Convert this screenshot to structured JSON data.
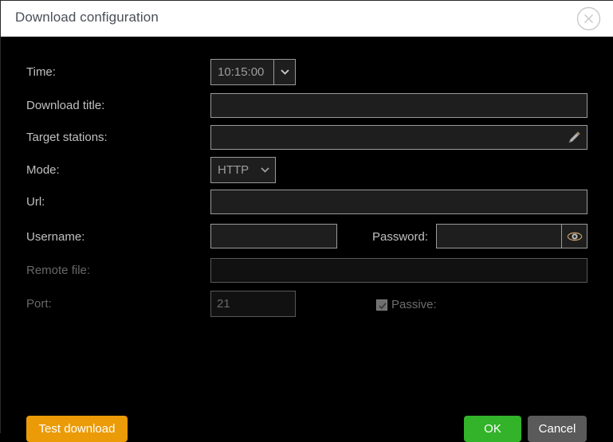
{
  "titlebar": {
    "title": "Download configuration",
    "close_icon": "close-circle-icon"
  },
  "form": {
    "time": {
      "label": "Time:",
      "value": "10:15:00",
      "arrow_icon": "chevron-down-icon"
    },
    "download_title": {
      "label": "Download title:",
      "value": ""
    },
    "target_stations": {
      "label": "Target stations:",
      "value": "",
      "edit_icon": "pencil-icon"
    },
    "mode": {
      "label": "Mode:",
      "value": "HTTP",
      "arrow_icon": "chevron-down-icon"
    },
    "url": {
      "label": "Url:",
      "value": ""
    },
    "username": {
      "label": "Username:",
      "value": ""
    },
    "password": {
      "label": "Password:",
      "value": "",
      "reveal_icon": "eye-icon"
    },
    "remote_file": {
      "label": "Remote file:",
      "value": ""
    },
    "port": {
      "label": "Port:",
      "value": "21"
    },
    "passive": {
      "label": "Passive:",
      "checked": true
    }
  },
  "buttons": {
    "test_download": "Test download",
    "ok": "OK",
    "cancel": "Cancel"
  },
  "colors": {
    "accent_orange": "#eb9b07",
    "accent_green": "#32b32a",
    "cancel_gray": "#5a5a5a",
    "background": "#000000",
    "titlebar": "#ffffff"
  }
}
